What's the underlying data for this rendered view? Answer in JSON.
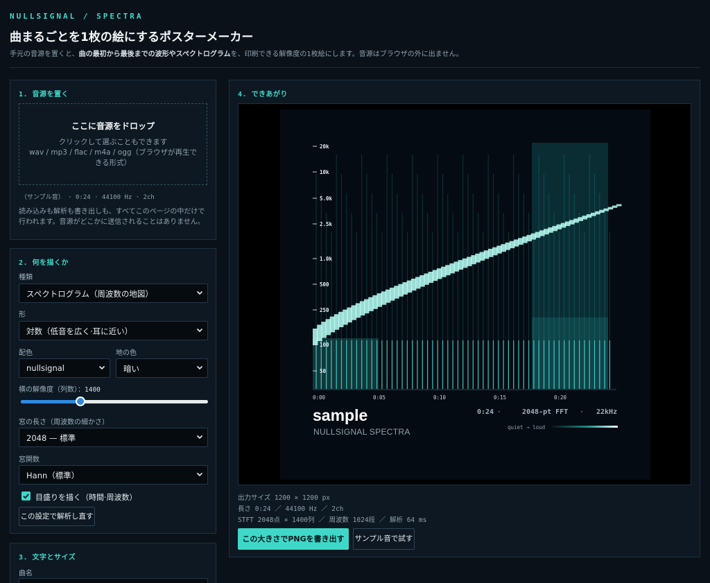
{
  "header": {
    "brand": "NULLSIGNAL / SPECTRA",
    "title": "曲まるごとを1枚の絵にするポスターメーカー",
    "subtitle_a": "手元の音源を置くと、",
    "subtitle_b": "曲の最初から最後までの波形やスペクトログラム",
    "subtitle_c": "を、印刷できる解像度の1枚絵にします。音源はブラウザの外に出ません。"
  },
  "section1": {
    "heading": "1. 音源を置く",
    "drop_title": "ここに音源をドロップ",
    "drop_line1": "クリックして選ぶこともできます",
    "drop_line2": "wav / mp3 / flac / m4a / ogg（ブラウザが再生できる形式）",
    "file_info": "（サンプル音） · 0:24 · 44100 Hz · 2ch",
    "privacy_note": "読み込みも解析も書き出しも、すべてこのページの中だけで行われます。音源がどこかに送信されることはありません。"
  },
  "section2": {
    "heading": "2. 何を描くか",
    "kind_label": "種類",
    "kind_value": "スペクトログラム（周波数の地図）",
    "shape_label": "形",
    "shape_value": "対数（低音を広く·耳に近い）",
    "palette_label": "配色",
    "palette_value": "nullsignal",
    "bg_label": "地の色",
    "bg_value": "暗い",
    "resolution_label": "横の解像度（列数）：",
    "resolution_value": "1400",
    "resolution_fraction": 0.32,
    "window_label": "窓の長さ（周波数の細かさ）",
    "window_value": "2048 — 標準",
    "func_label": "窓関数",
    "func_value": "Hann（標準）",
    "grid_checkbox_label": "目盛りを描く（時間·周波数）",
    "grid_checked": true,
    "reanalyze_button": "この設定で解析し直す"
  },
  "section3": {
    "heading": "3. 文字とサイズ",
    "song_label": "曲名"
  },
  "section4": {
    "heading": "4. できあがり",
    "output_size": "出力サイズ 1200 × 1200 px",
    "length_info": "長さ 0:24 ／ 44100 Hz ／ 2ch",
    "stft_info": "STFT 2048点 × 1400列 ／ 周波数 1024段 ／ 解析 64 ms",
    "export_button": "この大きさでPNGを書き出す",
    "sample_button": "サンプル音で試す"
  },
  "poster": {
    "freq_ticks": [
      "20k",
      "10k",
      "5.0k",
      "2.5k",
      "1.0k",
      "500",
      "250",
      "100",
      "50"
    ],
    "time_ticks": [
      "0:00",
      "0:05",
      "0:10",
      "0:15",
      "0:20"
    ],
    "song_title": "sample",
    "artist": "NULLSIGNAL SPECTRA",
    "duration": "0:24",
    "sep1": "·",
    "fft": "2048-pt FFT",
    "sep2": "·",
    "max_freq": "22kHz",
    "legend": "quiet → loud",
    "accent": "#3fd8c8"
  }
}
